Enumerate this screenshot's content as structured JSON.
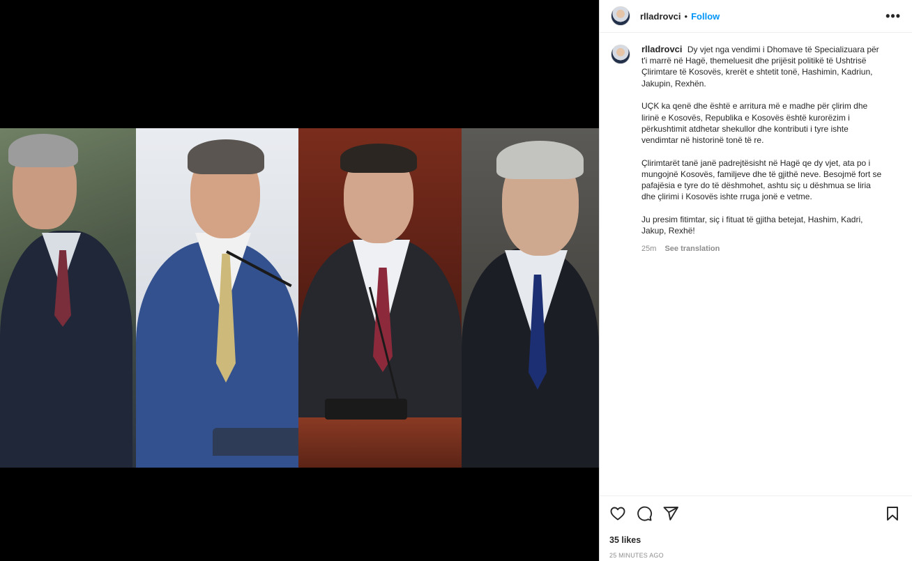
{
  "post": {
    "username": "rlladrovci",
    "separator": "•",
    "follow_label": "Follow",
    "more_label": "•••",
    "caption_paragraphs": [
      "Dy vjet nga vendimi i Dhomave të Specializuara për t'i marrë në Hagë, themeluesit dhe prijësit politikë të Ushtrisë Çlirimtare të Kosovës, krerët e shtetit tonë, Hashimin, Kadriun, Jakupin, Rexhën.",
      "UÇK ka qenë dhe është e arritura më e madhe për çlirim dhe lirinë e Kosovës, Republika e Kosovës është kurorëzim i përkushtimit atdhetar shekullor dhe kontributi i tyre ishte vendimtar në historinë tonë të re.",
      "Çlirimtarët tanë janë padrejtësisht në Hagë qe dy vjet, ata po i mungojnë Kosovës, familjeve dhe të gjithë neve. Besojmë fort se pafajësia e tyre do të dëshmohet, ashtu siç u dëshmua se liria dhe çlirimi i Kosovës ishte rruga jonë e vetme.",
      "Ju presim fitimtar, siç i fituat të gjitha betejat, Hashim, Kadri, Jakup, Rexhë!"
    ],
    "time_short": "25m",
    "translate_label": "See translation",
    "likes": "35 likes",
    "time_long": "25 MINUTES AGO"
  },
  "icons": {
    "like": "heart-icon",
    "comment": "comment-icon",
    "share": "share-icon",
    "save": "bookmark-icon",
    "more": "more-icon"
  },
  "colors": {
    "accent": "#0095f6",
    "text": "#262626",
    "muted": "#8e8e8e",
    "media_bg": "#000000"
  }
}
